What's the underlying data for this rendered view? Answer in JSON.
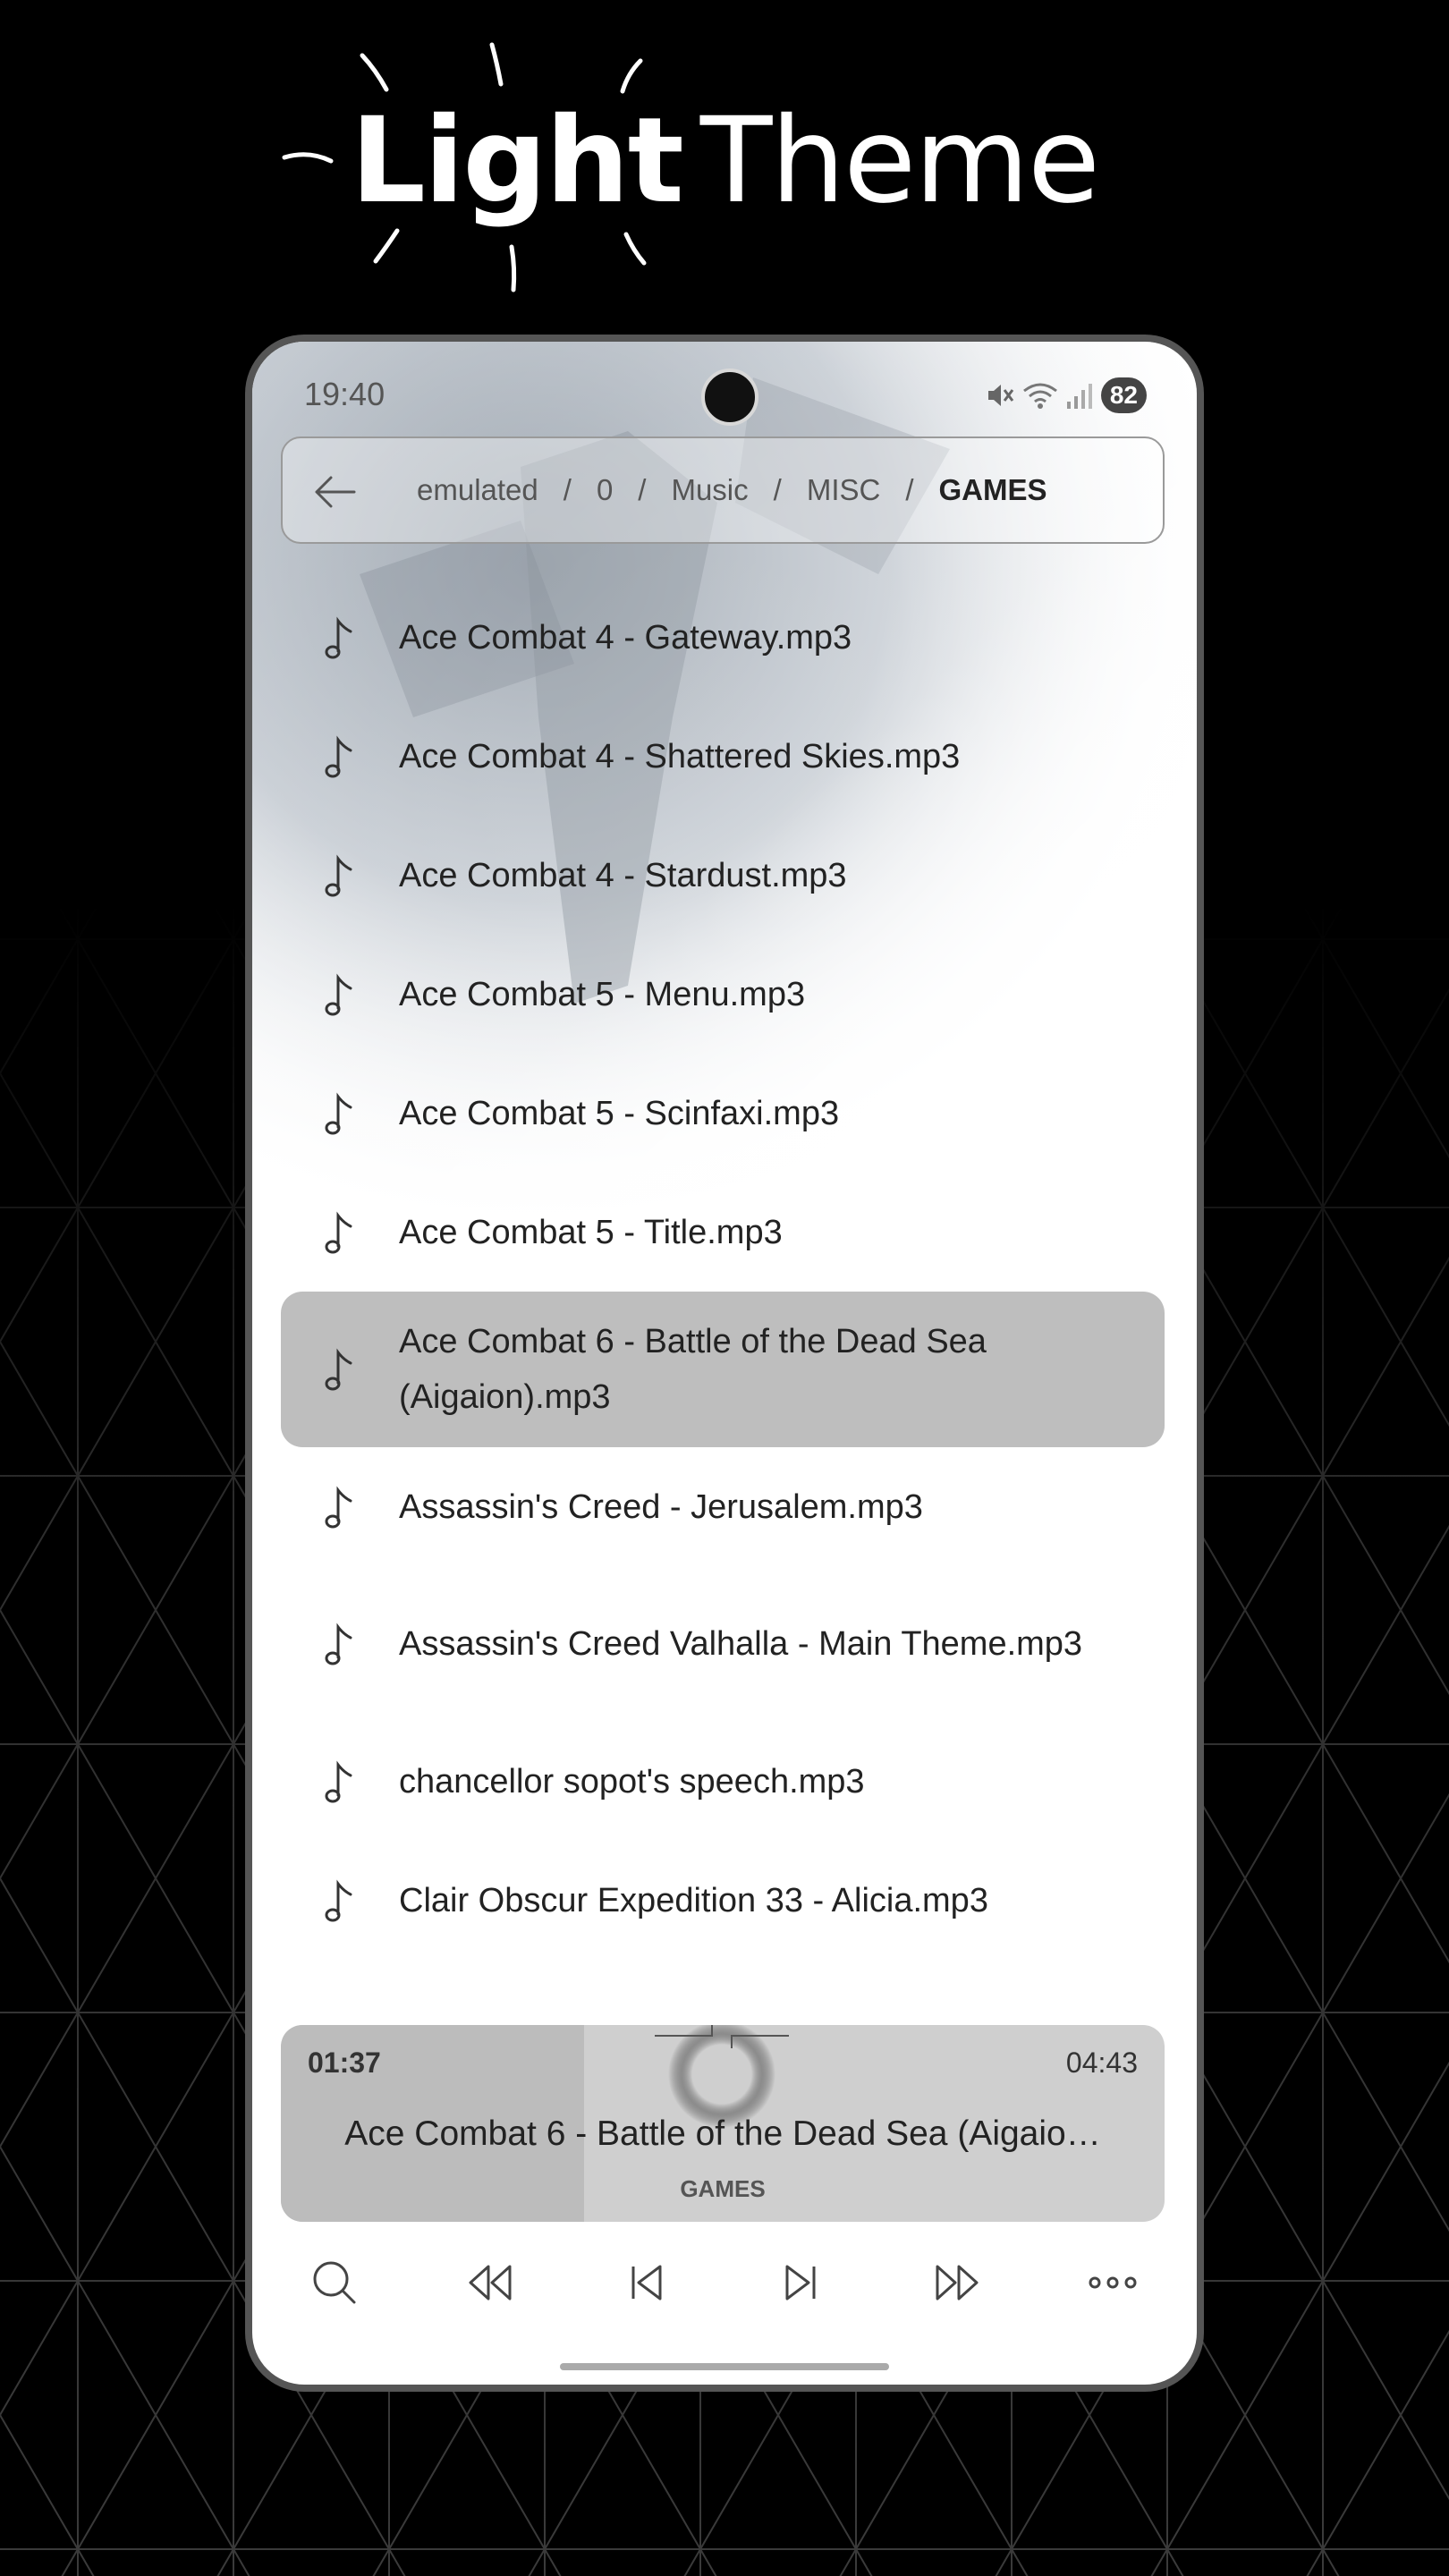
{
  "headline": {
    "bold": "Light",
    "regular": "Theme"
  },
  "status_bar": {
    "time": "19:40",
    "battery": "82"
  },
  "path": {
    "segments": [
      "emulated",
      "0",
      "Music",
      "MISC"
    ],
    "current": "GAMES",
    "separator": "/"
  },
  "files": [
    {
      "name": "Ace Combat 4 - Gateway.mp3"
    },
    {
      "name": "Ace Combat 4 - Shattered Skies.mp3"
    },
    {
      "name": "Ace Combat 4 - Stardust.mp3"
    },
    {
      "name": "Ace Combat 5 - Menu.mp3"
    },
    {
      "name": "Ace Combat 5 - Scinfaxi.mp3"
    },
    {
      "name": "Ace Combat 5 - Title.mp3"
    },
    {
      "name": "Ace Combat 6 - Battle of the Dead Sea (Aigaion).mp3"
    },
    {
      "name": "Assassin's Creed - Jerusalem.mp3"
    },
    {
      "name": "Assassin's Creed Valhalla - Main Theme.mp3"
    },
    {
      "name": "chancellor sopot's speech.mp3"
    },
    {
      "name": "Clair Obscur Expedition 33 - Alicia.mp3"
    }
  ],
  "selected_index": 6,
  "now_playing": {
    "elapsed": "01:37",
    "duration": "04:43",
    "title": "Ace Combat 6 - Battle of the Dead Sea (Aigaio…",
    "folder": "GAMES",
    "progress": 0.343
  },
  "controls": [
    "search-icon",
    "rewind-icon",
    "previous-icon",
    "next-icon",
    "fast-forward-icon",
    "more-icon"
  ],
  "colors": {
    "selected_row": "#bebebe",
    "player_bg": "#cfcfcf",
    "player_played": "#bcbcbc"
  }
}
